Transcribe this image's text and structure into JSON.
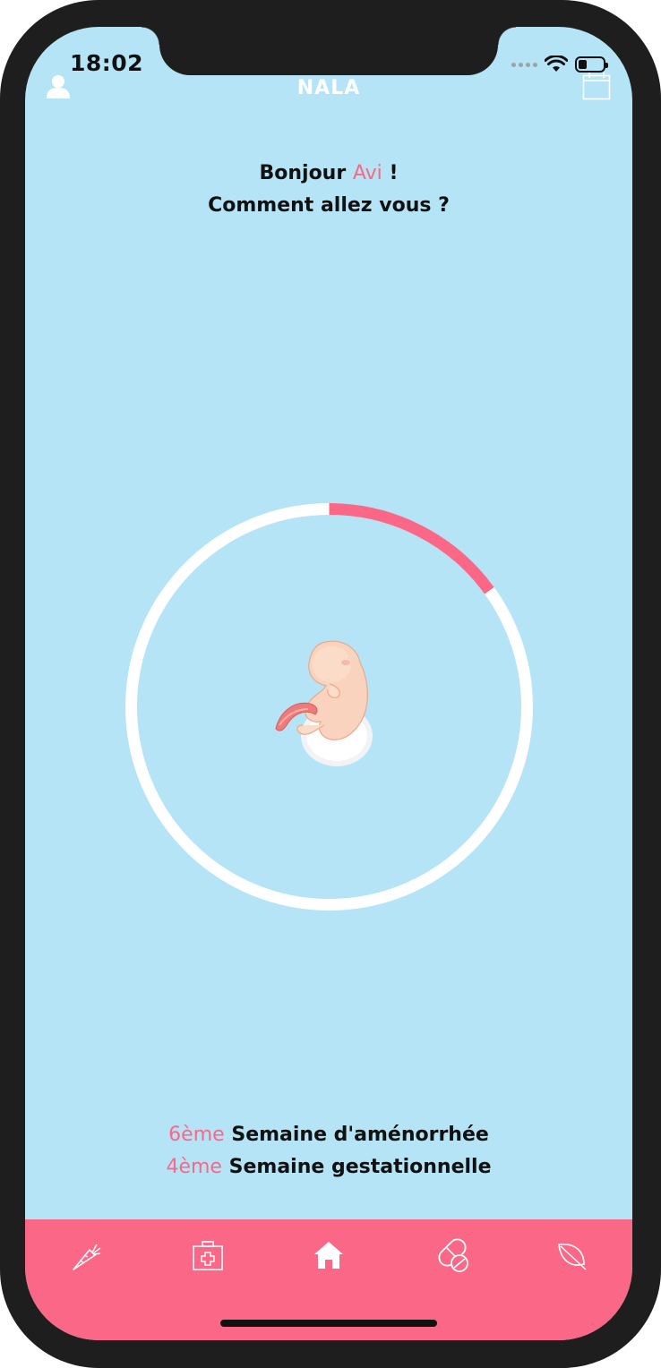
{
  "status_bar": {
    "time": "18:02"
  },
  "header": {
    "title": "NALA",
    "left_icon": "profile-icon",
    "right_icon": "calendar-icon"
  },
  "greeting": {
    "line1_prefix": "Bonjour",
    "name": "Avi",
    "line1_suffix": "!",
    "line2": "Comment allez vous ?"
  },
  "progress": {
    "fraction": 0.15,
    "track_color": "#ffffff",
    "fill_color": "#fb6887"
  },
  "weeks": [
    {
      "number": "6ème",
      "label": "Semaine d'aménorrhée"
    },
    {
      "number": "4ème",
      "label": "Semaine gestationnelle"
    }
  ],
  "tabbar": {
    "items": [
      {
        "icon": "carrot-icon"
      },
      {
        "icon": "medical-kit-icon"
      },
      {
        "icon": "home-icon",
        "active": true
      },
      {
        "icon": "pills-icon"
      },
      {
        "icon": "leaf-icon"
      }
    ]
  },
  "colors": {
    "background": "#b4e4f5",
    "accent": "#fb6887"
  }
}
